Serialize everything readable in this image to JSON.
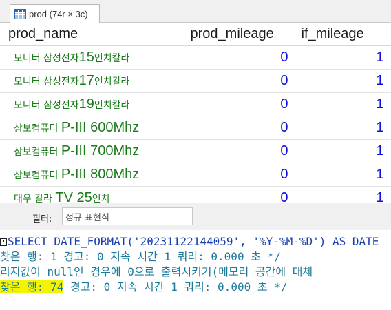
{
  "tab": {
    "label": "prod (74r × 3c)",
    "icon": "table-grid-icon"
  },
  "grid": {
    "columns": [
      "prod_name",
      "prod_mileage",
      "if_mileage"
    ],
    "rows": [
      {
        "name_ko": "모니터 삼성전자",
        "name_rest": "15",
        "name_tail": "인치칼라",
        "mileage": "0",
        "if_mileage": "1"
      },
      {
        "name_ko": "모니터 삼성전자",
        "name_rest": "17",
        "name_tail": "인치칼라",
        "mileage": "0",
        "if_mileage": "1"
      },
      {
        "name_ko": "모니터 삼성전자",
        "name_rest": "19",
        "name_tail": "인치칼라",
        "mileage": "0",
        "if_mileage": "1"
      },
      {
        "name_ko": "삼보컴퓨터 ",
        "name_rest": "P-III 600Mhz",
        "name_tail": "",
        "mileage": "0",
        "if_mileage": "1"
      },
      {
        "name_ko": "삼보컴퓨터 ",
        "name_rest": "P-III 700Mhz",
        "name_tail": "",
        "mileage": "0",
        "if_mileage": "1"
      },
      {
        "name_ko": "삼보컴퓨터 ",
        "name_rest": "P-III 800Mhz",
        "name_tail": "",
        "mileage": "0",
        "if_mileage": "1"
      },
      {
        "name_ko": "대우 칼라 ",
        "name_rest": "TV 25",
        "name_tail": "인치",
        "mileage": "0",
        "if_mileage": "1"
      }
    ]
  },
  "filter": {
    "label": "필터:",
    "value": "정규 표현식"
  },
  "log": {
    "line1": "SELECT DATE_FORMAT('20231122144059', '%Y-%M-%D') AS DATE",
    "line2": "찾은 행: 1  경고: 0  지속 시간 1 쿼리: 0.000 초 */",
    "line3": "리지값이 null인 경우에 0으로 출력시키기(메모리 공간에 대체",
    "line4_hl": "찾은 행: 74",
    "line4_rest": "  경고: 0  지속 시간 1 쿼리: 0.000 초 */"
  }
}
